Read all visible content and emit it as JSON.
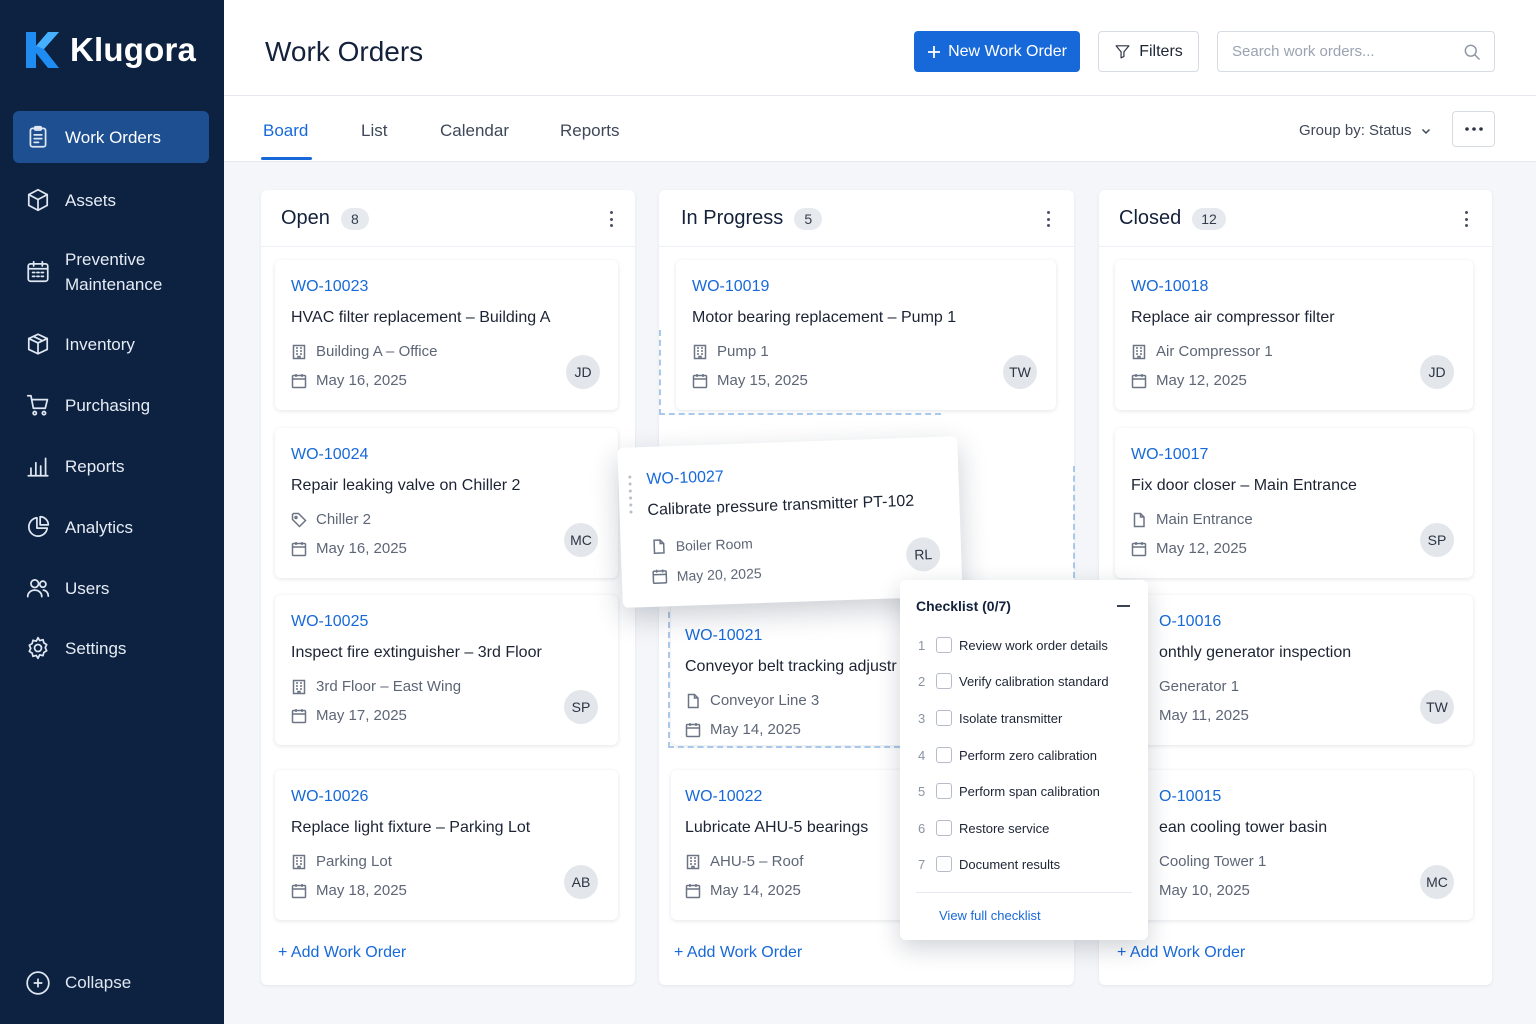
{
  "app": {
    "name": "Klugora"
  },
  "sidebar": {
    "items": [
      {
        "label": "Work Orders",
        "icon": "clipboard-icon",
        "active": true
      },
      {
        "label": "Assets",
        "icon": "cube-icon"
      },
      {
        "label": "Preventive\nMaintenance",
        "icon": "calendar-grid-icon"
      },
      {
        "label": "Inventory",
        "icon": "box-icon"
      },
      {
        "label": "Purchasing",
        "icon": "cart-icon"
      },
      {
        "label": "Reports",
        "icon": "bar-chart-icon"
      },
      {
        "label": "Analytics",
        "icon": "pie-chart-icon"
      },
      {
        "label": "Users",
        "icon": "users-icon"
      },
      {
        "label": "Settings",
        "icon": "gear-icon"
      }
    ],
    "collapse_label": "Collapse"
  },
  "header": {
    "title": "Work Orders",
    "new_button": "New Work Order",
    "filters_button": "Filters",
    "search_placeholder": "Search work orders..."
  },
  "tabs": {
    "items": [
      "Board",
      "List",
      "Calendar",
      "Reports"
    ],
    "active": "Board",
    "group_by": "Group by: Status"
  },
  "columns": [
    {
      "title": "Open",
      "count": "8",
      "cards": [
        {
          "id": "WO-10023",
          "title": "HVAC filter replacement – Building A",
          "location": "Building A – Office",
          "date": "May 16, 2025",
          "assignee": "JD",
          "loc_icon": "building-icon"
        },
        {
          "id": "WO-10024",
          "title": "Repair leaking valve on Chiller 2",
          "location": "Chiller 2",
          "date": "May 16, 2025",
          "assignee": "MC",
          "loc_icon": "tag-icon"
        },
        {
          "id": "WO-10025",
          "title": "Inspect fire extinguisher – 3rd Floor",
          "location": "3rd Floor – East Wing",
          "date": "May 17, 2025",
          "assignee": "SP",
          "loc_icon": "building-icon"
        },
        {
          "id": "WO-10026",
          "title": "Replace light fixture – Parking Lot",
          "location": "Parking Lot",
          "date": "May 18, 2025",
          "assignee": "AB",
          "loc_icon": "building-icon"
        }
      ],
      "add_label": "+ Add Work Order"
    },
    {
      "title": "In Progress",
      "count": "5",
      "cards": [
        {
          "id": "WO-10019",
          "title": "Motor bearing replacement – Pump 1",
          "location": "Pump 1",
          "date": "May 15, 2025",
          "assignee": "TW",
          "loc_icon": "building-icon"
        },
        {
          "id": "WO-10021",
          "title": "Conveyor belt tracking adjustr",
          "location": "Conveyor Line 3",
          "date": "May 14, 2025",
          "assignee": "",
          "loc_icon": "asset-icon"
        },
        {
          "id": "WO-10022",
          "title": "Lubricate AHU-5 bearings",
          "location": "AHU-5 – Roof",
          "date": "May 14, 2025",
          "assignee": "",
          "loc_icon": "building-icon"
        }
      ],
      "add_label": "+ Add Work Order"
    },
    {
      "title": "Closed",
      "count": "12",
      "cards": [
        {
          "id": "WO-10018",
          "title": "Replace air compressor filter",
          "location": "Air Compressor 1",
          "date": "May 12, 2025",
          "assignee": "JD",
          "loc_icon": "building-icon"
        },
        {
          "id": "WO-10017",
          "title": "Fix door closer – Main Entrance",
          "location": "Main Entrance",
          "date": "May 12, 2025",
          "assignee": "SP",
          "loc_icon": "asset-icon"
        },
        {
          "id": "O-10016",
          "title": "onthly generator inspection",
          "location": "Generator 1",
          "date": "May 11, 2025",
          "assignee": "TW",
          "loc_icon": "building-icon"
        },
        {
          "id": "O-10015",
          "title": "ean cooling tower basin",
          "location": "Cooling Tower 1",
          "date": "May 10, 2025",
          "assignee": "MC",
          "loc_icon": "building-icon"
        }
      ],
      "add_label": "+ Add Work Order"
    }
  ],
  "dragged_card": {
    "id": "WO-10027",
    "title": "Calibrate pressure transmitter PT-102",
    "location": "Boiler Room",
    "date": "May 20, 2025",
    "assignee": "RL"
  },
  "checklist": {
    "title": "Checklist (0/7)",
    "items": [
      {
        "num": "1",
        "label": "Review work order details"
      },
      {
        "num": "2",
        "label": "Verify calibration standard"
      },
      {
        "num": "3",
        "label": "Isolate transmitter"
      },
      {
        "num": "4",
        "label": "Perform zero calibration"
      },
      {
        "num": "5",
        "label": "Perform span calibration"
      },
      {
        "num": "6",
        "label": "Restore service"
      },
      {
        "num": "7",
        "label": "Document results"
      }
    ],
    "link": "View full checklist"
  },
  "colors": {
    "sidebar_bg": "#0d2240",
    "accent": "#1769d9",
    "active_nav": "#1d4f91"
  }
}
